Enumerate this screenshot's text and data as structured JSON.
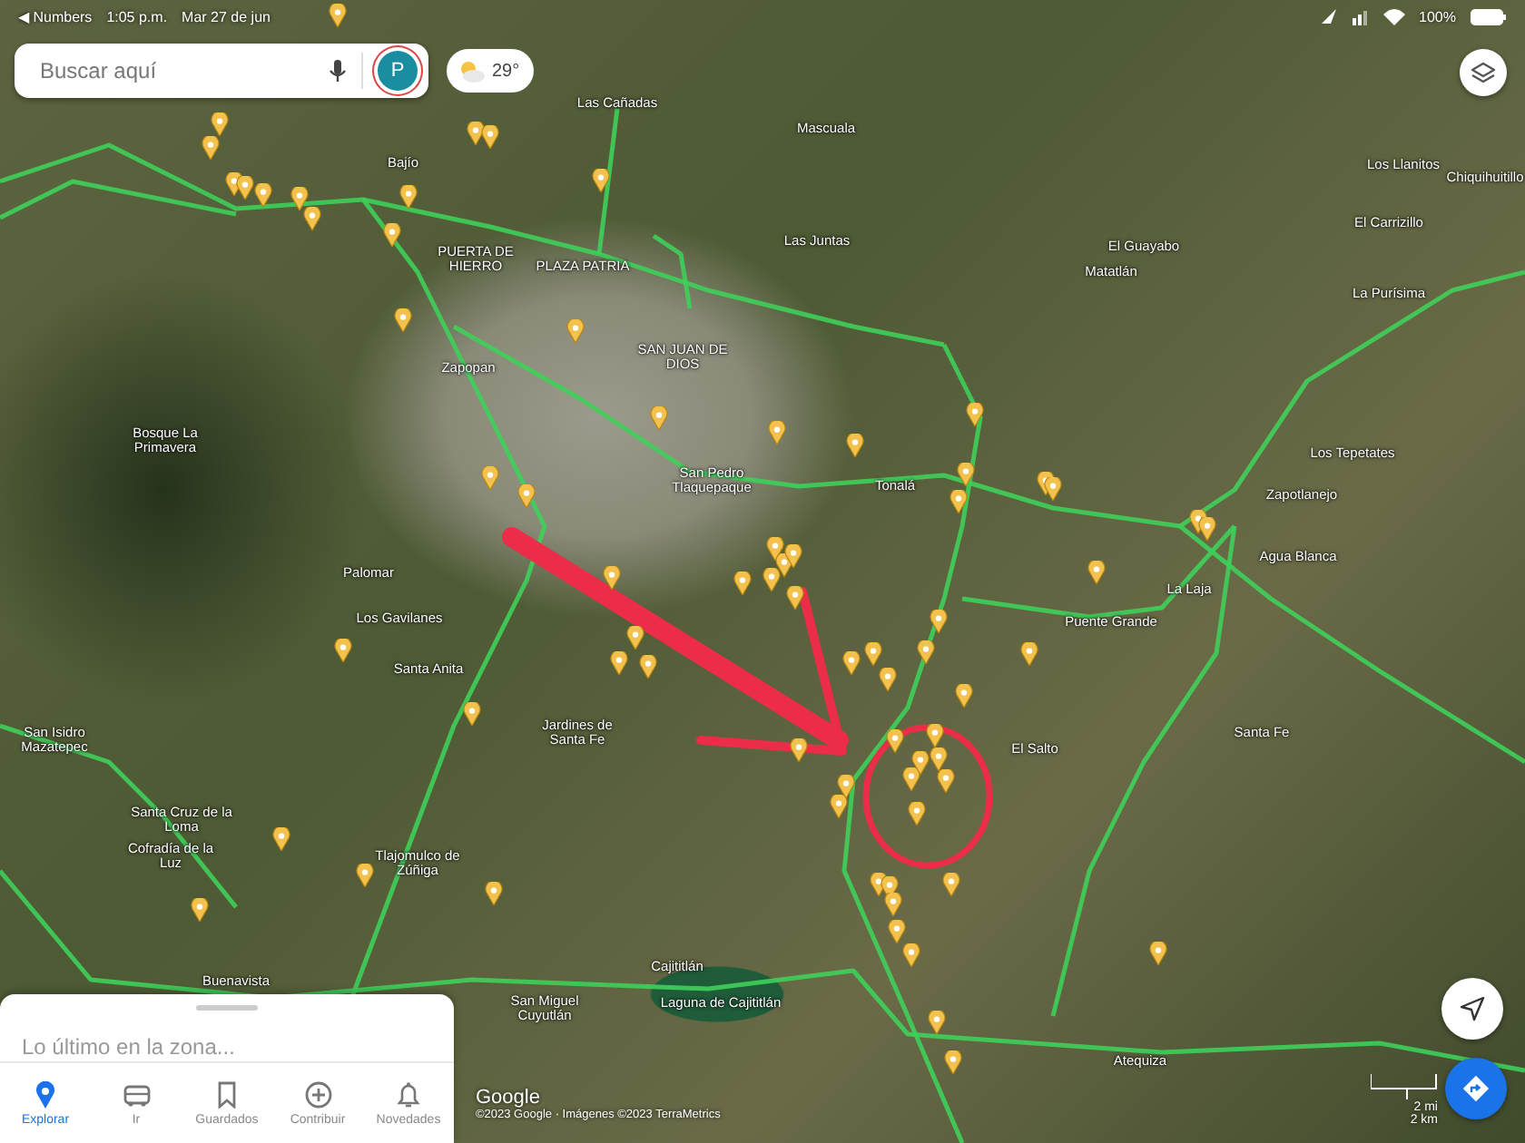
{
  "status_bar": {
    "back_app": "◀ Numbers",
    "time": "1:05 p.m.",
    "date": "Mar 27 de jun",
    "battery": "100%"
  },
  "search": {
    "placeholder": "Buscar aquí",
    "avatar": "P"
  },
  "weather": {
    "temperature": "29°"
  },
  "map": {
    "places": [
      "Las Cañadas",
      "Mascuala",
      "Bajío",
      "Los Llanitos",
      "Chiquihuitillo",
      "El Carrizillo",
      "Las Juntas",
      "El Guayabo",
      "PUERTA DE HIERRO",
      "PLAZA PATRIA",
      "Matatlán",
      "La Purísima",
      "SAN JUAN DE DIOS",
      "Zapopan",
      "Bosque La Primavera",
      "Los Tepetates",
      "San Pedro Tlaquepaque",
      "Tonalá",
      "Zapotlanejo",
      "Agua Blanca",
      "Palomar",
      "La Laja",
      "Los Gavilanes",
      "Puente Grande",
      "Santa Anita",
      "San Isidro Mazatepec",
      "Jardines de Santa Fe",
      "El Salto",
      "Santa Fe",
      "Santa Cruz de la Loma",
      "Cofradía de la Luz",
      "Tlajomulco de Zúñiga",
      "Cajititlán",
      "Buenavista",
      "San Miguel Cuyutlán",
      "Laguna de Cajititlán",
      "Atequiza"
    ]
  },
  "attribution": {
    "logo": "Google",
    "copyright": "©2023 Google · Imágenes ©2023 TerraMetrics"
  },
  "scale": {
    "imperial": "2 mi",
    "metric": "2 km"
  },
  "bottom_sheet": {
    "title": "Lo último en la zona..."
  },
  "nav": [
    {
      "label": "Explorar",
      "selected": true
    },
    {
      "label": "Ir",
      "selected": false
    },
    {
      "label": "Guardados",
      "selected": false
    },
    {
      "label": "Contribuir",
      "selected": false
    },
    {
      "label": "Novedades",
      "selected": false
    }
  ]
}
